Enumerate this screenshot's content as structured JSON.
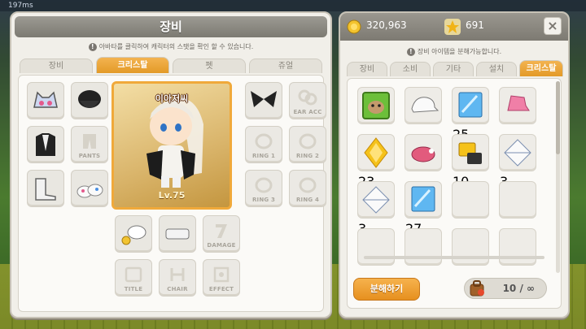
{
  "hud": {
    "ping": "197ms"
  },
  "equip_panel": {
    "title": "장비",
    "info": "아바타를 클릭하여 캐릭터의 스탯을 확인 할 수 있습니다.",
    "tabs": [
      {
        "label": "장비",
        "active": false
      },
      {
        "label": "크리스탈",
        "active": true
      },
      {
        "label": "펫",
        "active": false
      },
      {
        "label": "쥬얼",
        "active": false
      }
    ],
    "character": {
      "name": "이아저씨",
      "level": "Lv.75"
    },
    "slots": {
      "pants": "PANTS",
      "ear_acc": "EAR ACC",
      "ring1": "RING 1",
      "ring2": "RING 2",
      "ring3": "RING 3",
      "ring4": "RING 4",
      "damage": "DAMAGE",
      "title": "TITLE",
      "chair": "CHAIR",
      "effect": "EFFECT"
    }
  },
  "inventory_panel": {
    "mesos": "320,963",
    "crystals": "691",
    "close_label": "×",
    "info": "장비 아이템을 분해가능합니다.",
    "tabs": [
      {
        "label": "장비",
        "active": false
      },
      {
        "label": "소비",
        "active": false
      },
      {
        "label": "기타",
        "active": false
      },
      {
        "label": "설치",
        "active": false
      },
      {
        "label": "크리스탈",
        "active": true
      }
    ],
    "items": [
      {
        "icon": "beast-portrait-icon",
        "count": ""
      },
      {
        "icon": "white-cap-icon",
        "count": ""
      },
      {
        "icon": "30m-ticket-icon",
        "count": "25"
      },
      {
        "icon": "pink-gift-box-icon",
        "count": ""
      },
      {
        "icon": "golden-gem-icon",
        "count": "23"
      },
      {
        "icon": "pink-mount-icon",
        "count": ""
      },
      {
        "icon": "club-coupon-icon",
        "count": "10"
      },
      {
        "icon": "envelope-icon",
        "count": "3"
      },
      {
        "icon": "envelope-icon",
        "count": "3"
      },
      {
        "icon": "10m-ticket-icon",
        "count": "27"
      }
    ],
    "disassemble_label": "분해하기",
    "slot_count": "10 / ∞"
  },
  "colors": {
    "accent": "#e6901f",
    "panel": "#f1efe9"
  }
}
